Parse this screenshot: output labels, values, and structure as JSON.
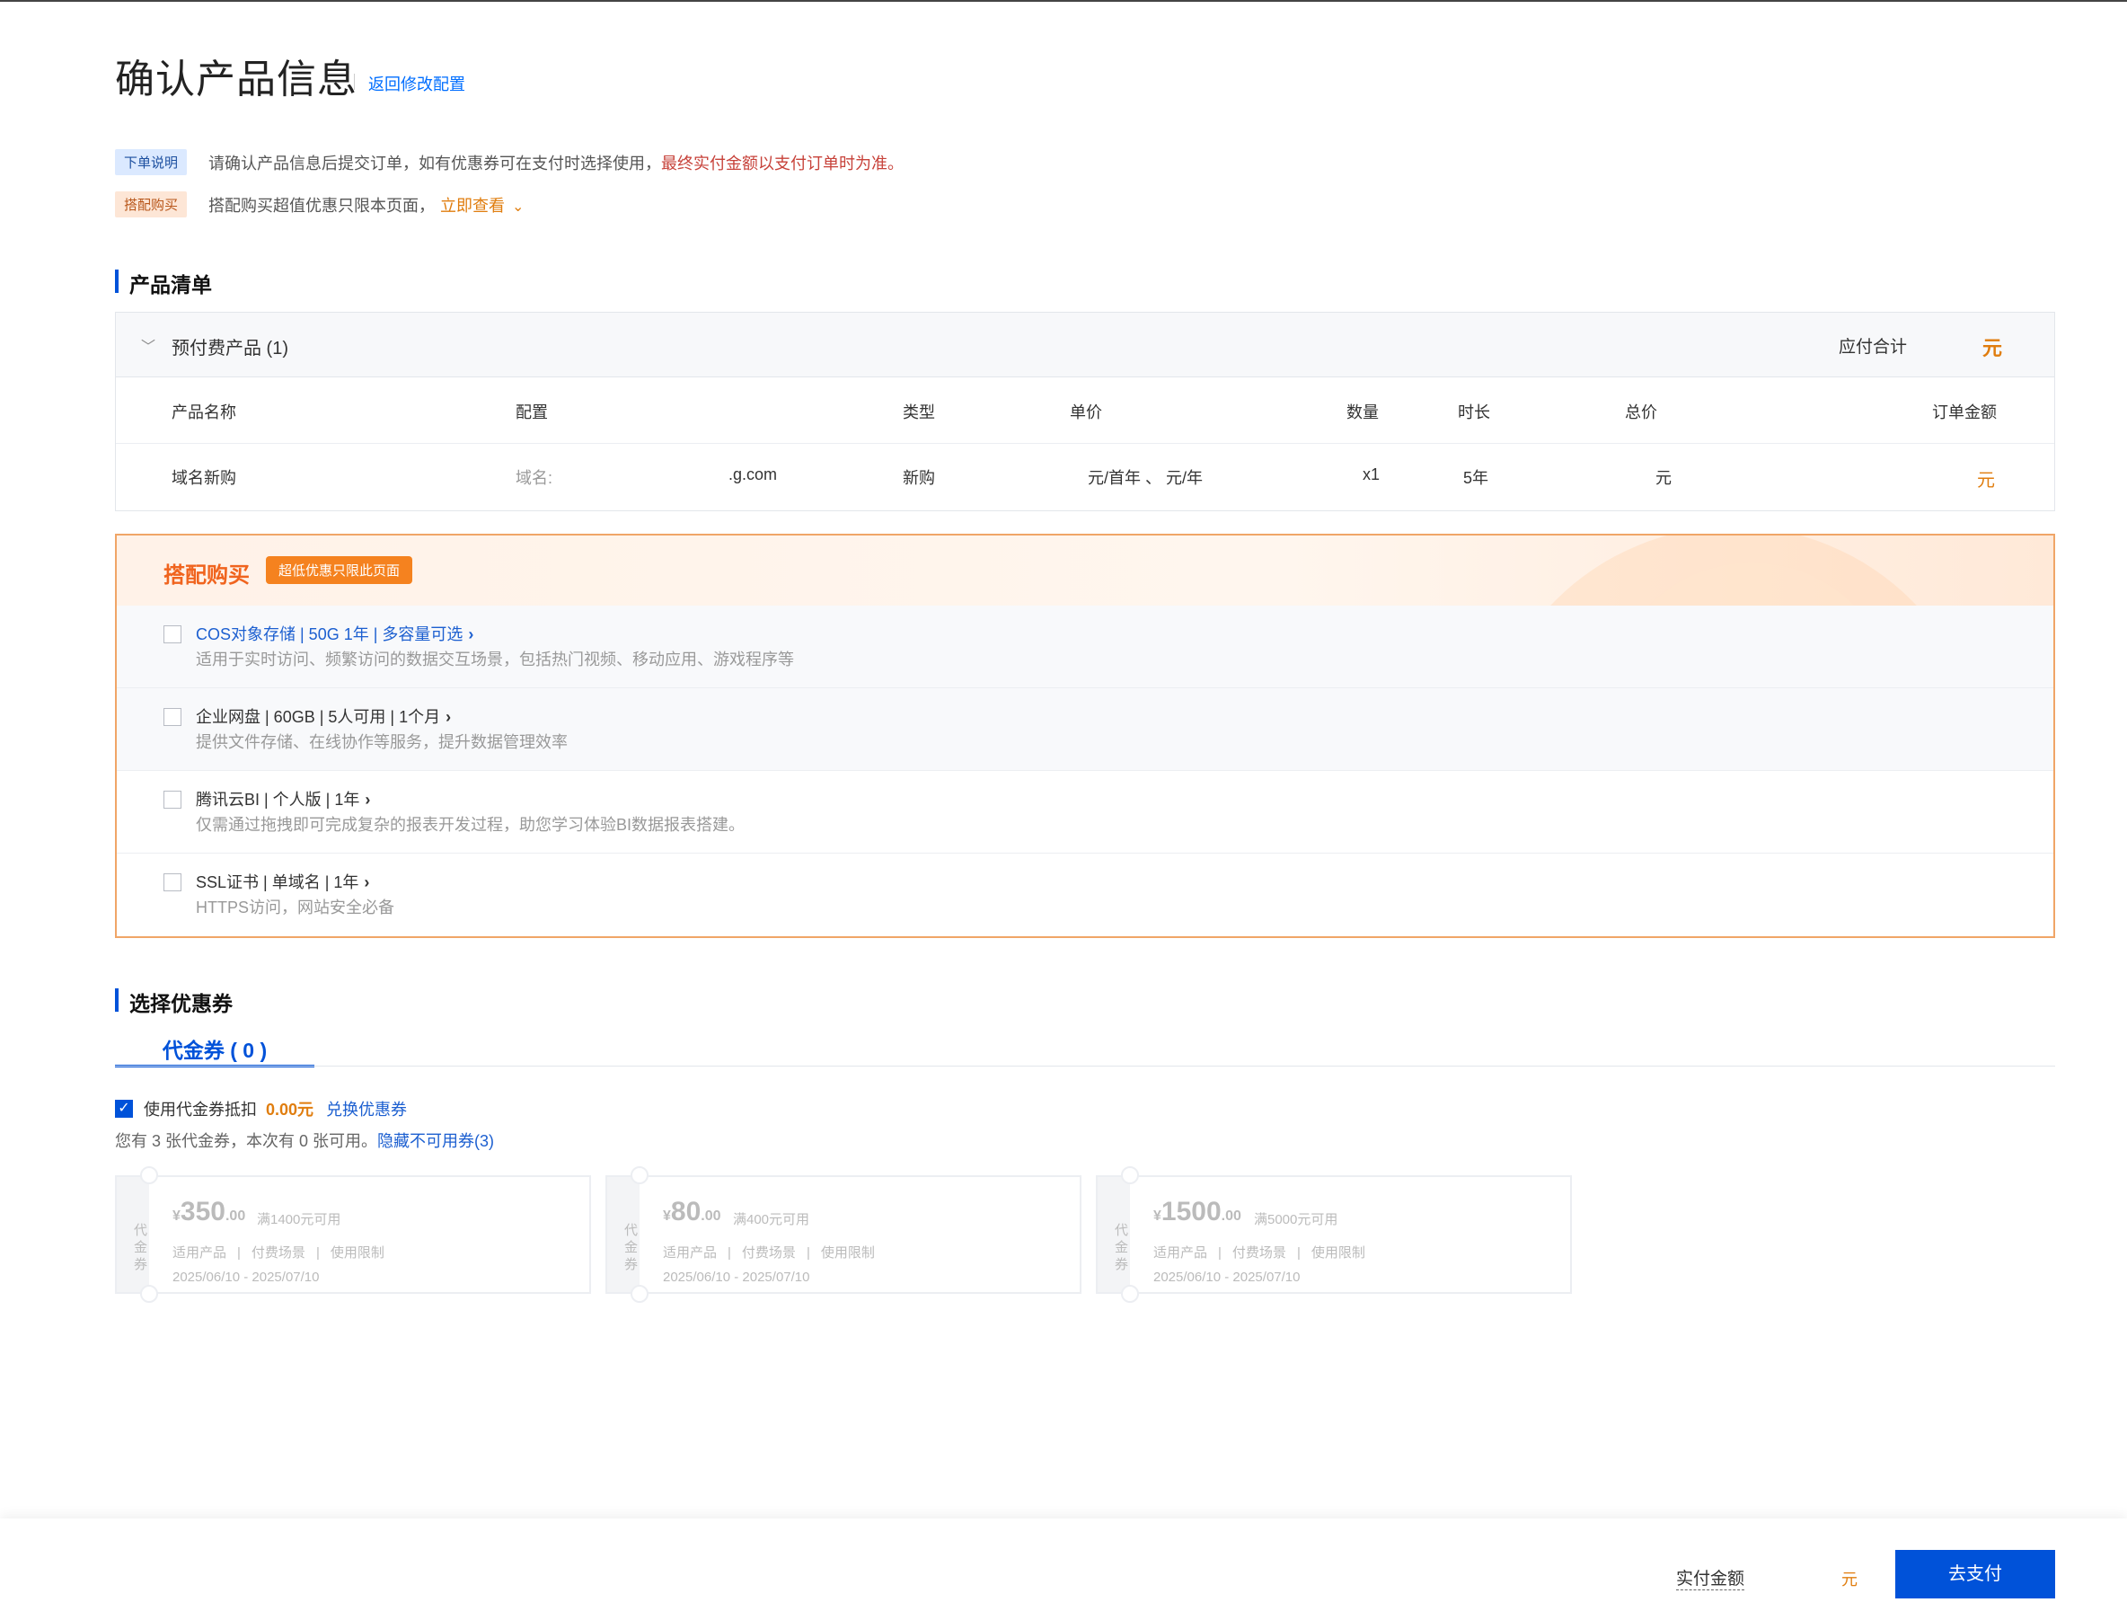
{
  "header": {
    "title": "确认产品信息",
    "back_link": "返回修改配置"
  },
  "notices": {
    "order_tag": "下单说明",
    "order_text": "请确认产品信息后提交订单，如有优惠券可在支付时选择使用，",
    "order_red": "最终实付金额以支付订单时为准。",
    "bundle_tag": "搭配购买",
    "bundle_text": "搭配购买超值优惠只限本页面，",
    "bundle_link": "立即查看"
  },
  "products": {
    "section_title": "产品清单",
    "group_label": "预付费产品 (1)",
    "due_label": "应付合计",
    "due_value": "元",
    "columns": [
      "产品名称",
      "配置",
      "类型",
      "单价",
      "数量",
      "时长",
      "总价",
      "订单金额"
    ],
    "row": {
      "name": "域名新购",
      "config_label": "域名:",
      "config_value": ".g.com",
      "type": "新购",
      "unit_price": "元/首年 、 元/年",
      "qty": "x1",
      "duration": "5年",
      "total": "元",
      "order_amount": "元"
    }
  },
  "bundle": {
    "title": "搭配购买",
    "badge": "超低优惠只限此页面",
    "items": [
      {
        "title": "COS对象存储 | 50G 1年 | 多容量可选",
        "desc": "适用于实时访问、频繁访问的数据交互场景，包括热门视频、移动应用、游戏程序等"
      },
      {
        "title": "企业网盘 | 60GB | 5人可用 | 1个月",
        "desc": "提供文件存储、在线协作等服务，提升数据管理效率"
      },
      {
        "title": "腾讯云BI | 个人版 | 1年",
        "desc": "仅需通过拖拽即可完成复杂的报表开发过程，助您学习体验BI数据报表搭建。"
      },
      {
        "title": "SSL证书 | 单域名 | 1年",
        "desc": "HTTPS访问，网站安全必备"
      }
    ]
  },
  "coupons": {
    "section_title": "选择优惠券",
    "tab_label": "代金券 ( 0 )",
    "use_label": "使用代金券抵扣",
    "use_amount": "0.00元",
    "exchange": "兑换优惠券",
    "info_text": "您有 3 张代金券，本次有 0 张可用。",
    "info_link": "隐藏不可用券(3)",
    "side_label": "代金券",
    "items": [
      {
        "yen": "¥",
        "big": "350",
        "small": ".00",
        "cond": "满1400元可用",
        "m1": "适用产品",
        "m2": "付费场景",
        "m3": "使用限制",
        "date": "2025/06/10 - 2025/07/10"
      },
      {
        "yen": "¥",
        "big": "80",
        "small": ".00",
        "cond": "满400元可用",
        "m1": "适用产品",
        "m2": "付费场景",
        "m3": "使用限制",
        "date": "2025/06/10 - 2025/07/10"
      },
      {
        "yen": "¥",
        "big": "1500",
        "small": ".00",
        "cond": "满5000元可用",
        "m1": "适用产品",
        "m2": "付费场景",
        "m3": "使用限制",
        "date": "2025/06/10 - 2025/07/10"
      }
    ]
  },
  "footer": {
    "pay_label": "实付金额",
    "pay_amount": "元",
    "pay_button": "去支付"
  },
  "colors": {
    "primary": "#0052d9",
    "accent_orange": "#e07d0e",
    "bundle_orange": "#f0641e",
    "warn_red": "#c7423a"
  }
}
